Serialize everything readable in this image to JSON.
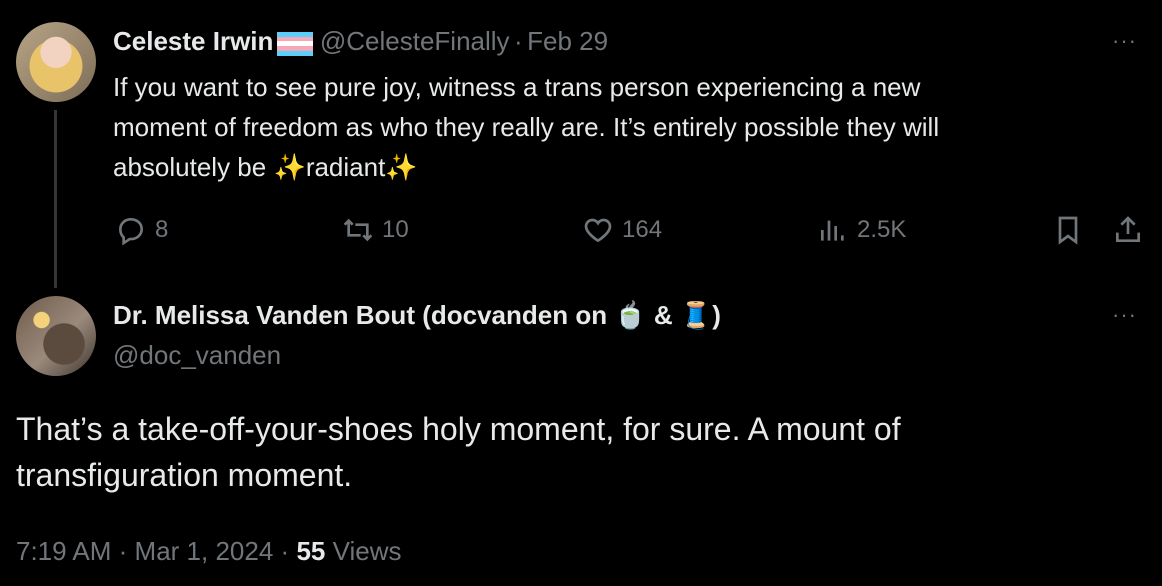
{
  "tweet1": {
    "name": "Celeste Irwin",
    "handle": "@CelesteFinally",
    "separator": "·",
    "date": "Feb 29",
    "more": "···",
    "text_lines": [
      "If you want to see pure joy, witness a trans person experiencing a new",
      "moment of freedom as who they really are. It’s entirely possible they will",
      "absolutely be ✨radiant✨"
    ],
    "actions": {
      "replies": "8",
      "reposts": "10",
      "likes": "164",
      "views": "2.5K"
    },
    "flag_colors": [
      "#5bcefa",
      "#f5a9b8",
      "#ffffff",
      "#f5a9b8",
      "#5bcefa"
    ]
  },
  "tweet2": {
    "name": "Dr. Melissa Vanden Bout (docvanden on 🍵 & 🧵)",
    "handle": "@doc_vanden",
    "more": "···",
    "text_lines": [
      "That’s a take-off-your-shoes holy moment, for sure. A mount of",
      "transfiguration moment."
    ],
    "time": "7:19 AM",
    "sep1": "·",
    "date": "Mar 1, 2024",
    "sep2": "·",
    "views_count": "55",
    "views_label": "Views"
  },
  "colors": {
    "background": "#000000",
    "text": "#e7e9ea",
    "muted": "#71767b"
  },
  "icons": [
    "reply-icon",
    "repost-icon",
    "like-icon",
    "views-icon",
    "bookmark-icon",
    "share-icon"
  ]
}
